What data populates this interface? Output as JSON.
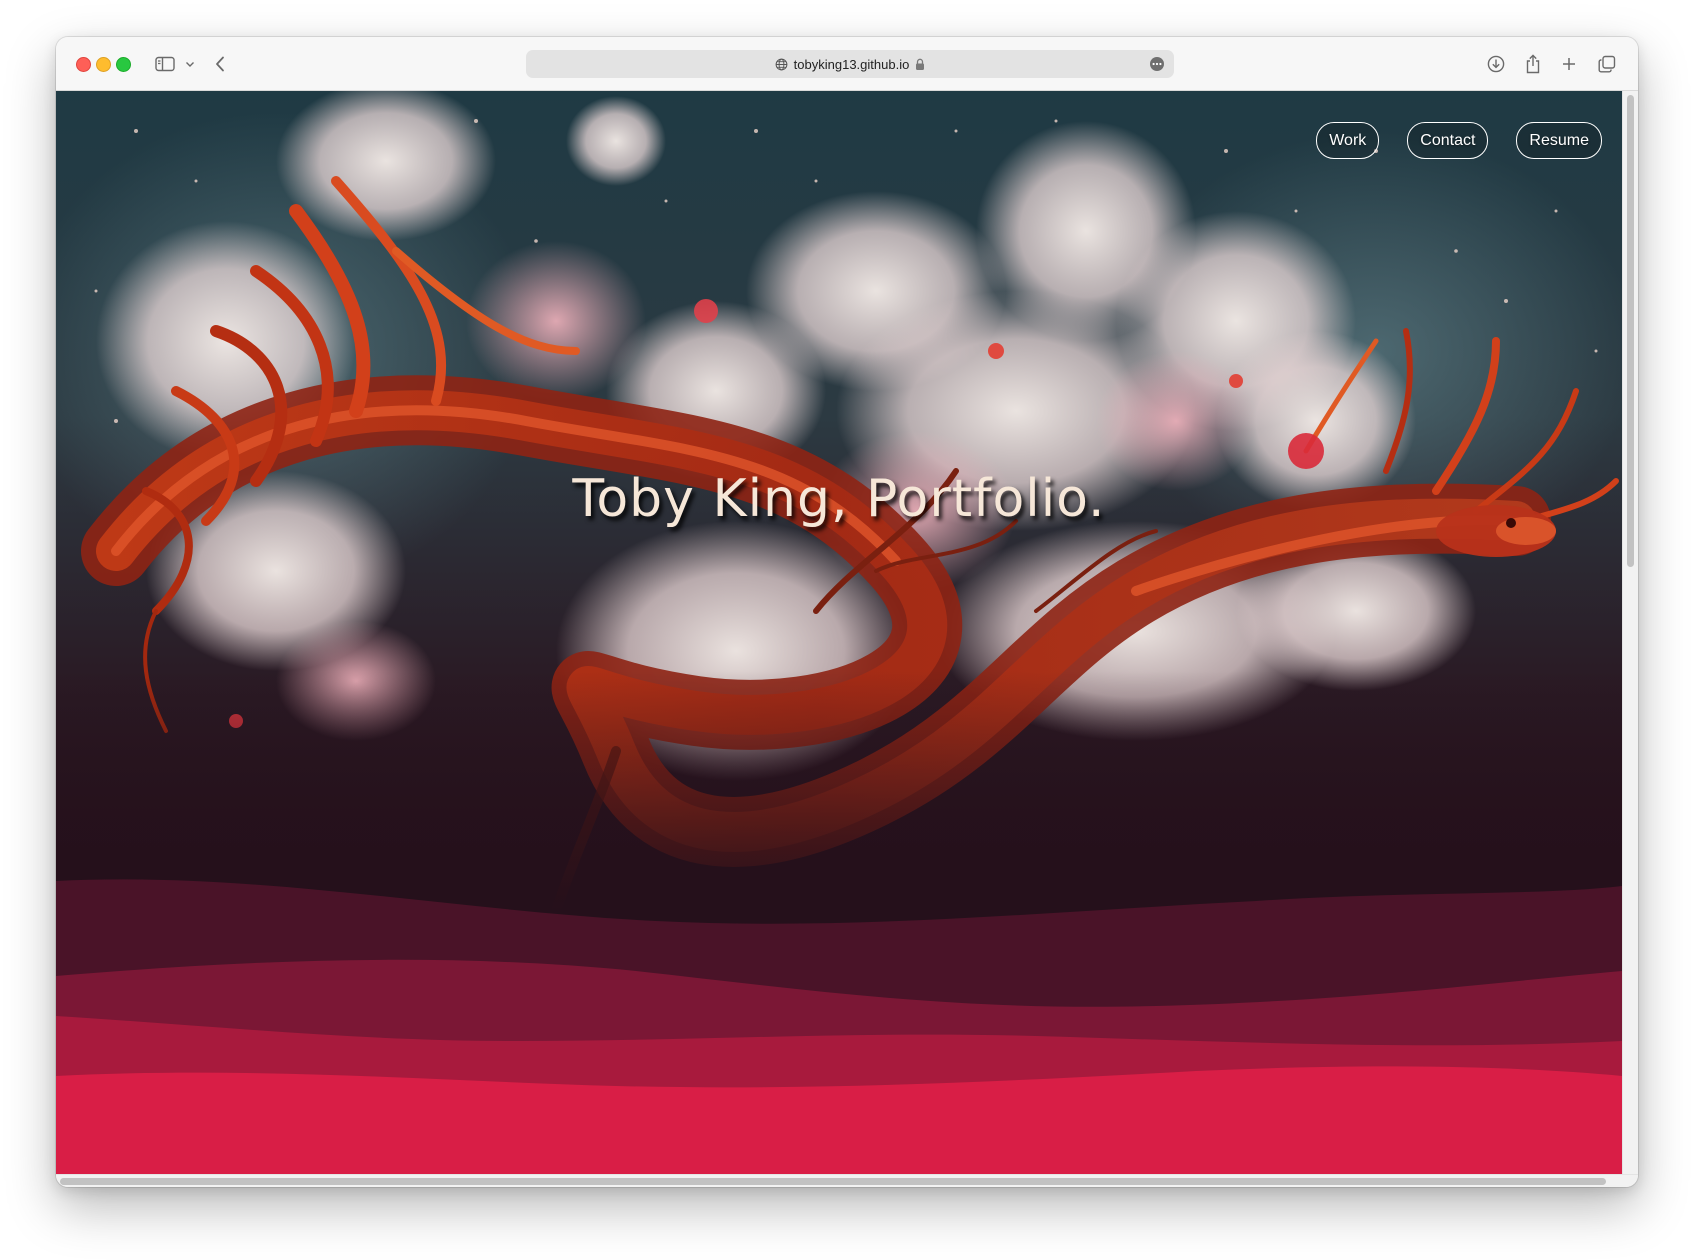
{
  "browser": {
    "url": "tobyking13.github.io",
    "icons": {
      "sidebar": "sidebar-toggle-icon",
      "chevron": "chevron-down-icon",
      "back": "back-arrow-icon",
      "globe": "globe-icon",
      "lock": "lock-icon",
      "more": "more-options-icon",
      "download": "download-icon",
      "share": "share-icon",
      "new_tab": "new-tab-icon",
      "tabs": "tab-overview-icon"
    }
  },
  "nav": {
    "work": "Work",
    "contact": "Contact",
    "resume": "Resume"
  },
  "hero": {
    "title": "Toby King, Portfolio."
  },
  "colors": {
    "wave_darkest": "#4a1328",
    "wave_dark": "#7b1735",
    "wave_mid": "#a81a3d",
    "wave_bright": "#d91e46",
    "background_dark": "#2a0f1a"
  }
}
